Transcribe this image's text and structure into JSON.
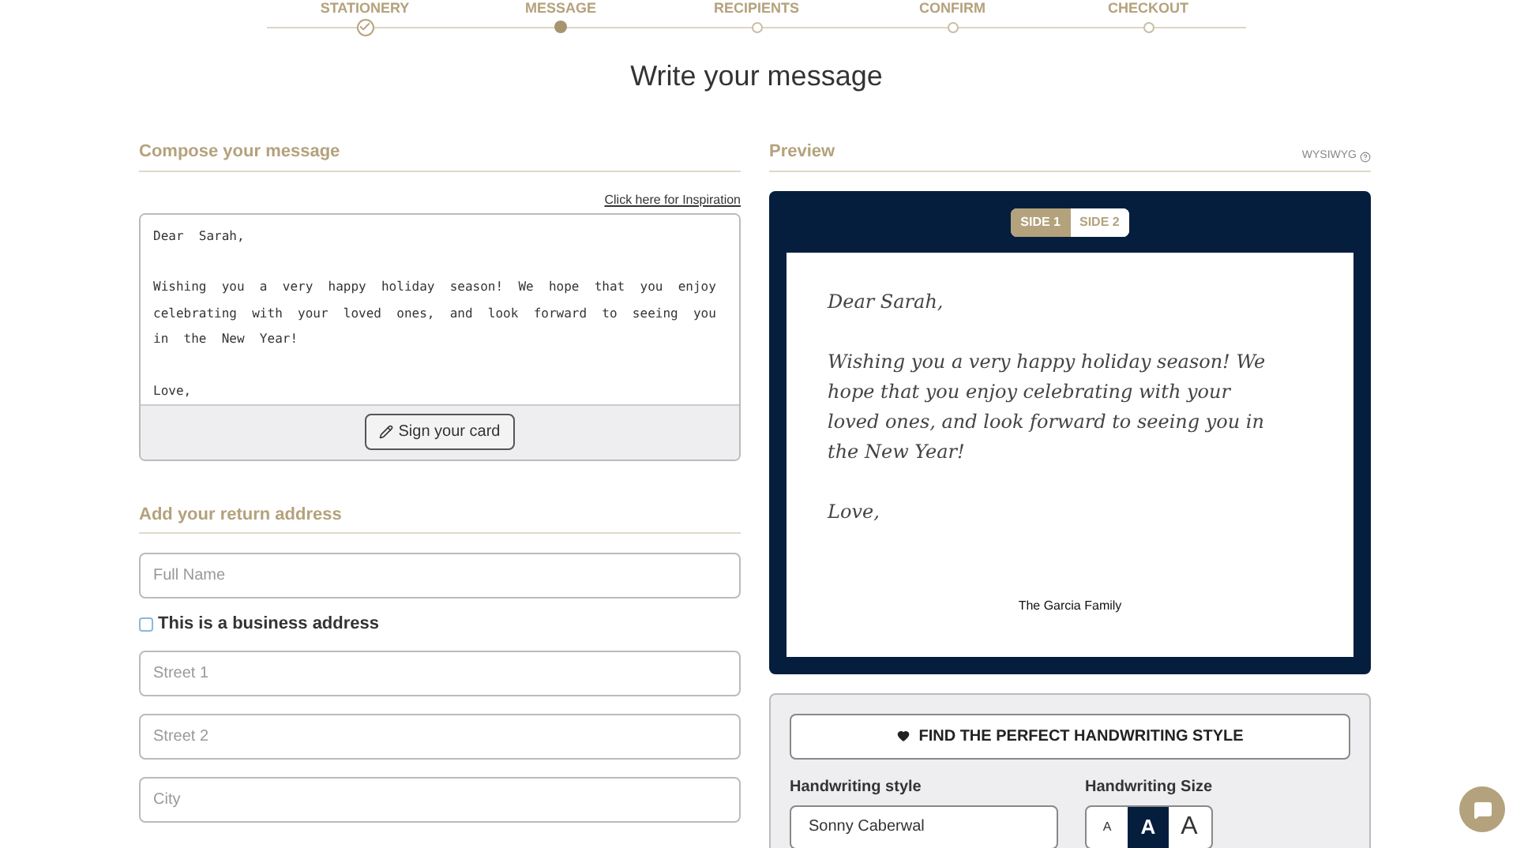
{
  "steps": [
    {
      "label": "STATIONERY",
      "kind": "done"
    },
    {
      "label": "MESSAGE",
      "kind": "current"
    },
    {
      "label": "RECIPIENTS",
      "kind": "pending"
    },
    {
      "label": "CONFIRM",
      "kind": "pending"
    },
    {
      "label": "CHECKOUT",
      "kind": "pending"
    }
  ],
  "page_title": "Write your message",
  "compose": {
    "heading": "Compose your message",
    "inspiration_link": "Click here for Inspiration",
    "message": "Dear  Sarah,\n\nWishing  you  a  very  happy  holiday  season!  We  hope  that  you  enjoy  celebrating  with  your  loved  ones,  and  look  forward  to  seeing  you  in  the  New  Year!\n\nLove,",
    "sign_button": "Sign your card"
  },
  "return_address": {
    "heading": "Add your return address",
    "fields": [
      {
        "placeholder": "Full Name"
      },
      {
        "kind": "checkbox",
        "label": "This is a business address",
        "checked": false
      },
      {
        "placeholder": "Street 1"
      },
      {
        "placeholder": "Street 2"
      },
      {
        "placeholder": "City"
      }
    ]
  },
  "preview": {
    "heading": "Preview",
    "mode_label": "WYSIWYG",
    "sides": [
      {
        "label": "SIDE 1",
        "selected": true
      },
      {
        "label": "SIDE 2",
        "selected": false
      }
    ],
    "card_lines": [
      "Dear Sarah,",
      "Wishing you a very happy holiday season! We hope that you enjoy celebrating with your loved ones, and look forward to seeing you in the New Year!",
      "Love,"
    ],
    "signature": "The Garcia Family"
  },
  "handwriting": {
    "find_button": "FIND THE PERFECT HANDWRITING STYLE",
    "style_label": "Handwriting style",
    "style_value": "Sonny Caberwal",
    "size_label": "Handwriting Size",
    "sizes": [
      {
        "label": "A",
        "kind": "small",
        "selected": false
      },
      {
        "label": "A",
        "kind": "medium",
        "selected": true
      },
      {
        "label": "A",
        "kind": "large",
        "selected": false
      }
    ]
  }
}
